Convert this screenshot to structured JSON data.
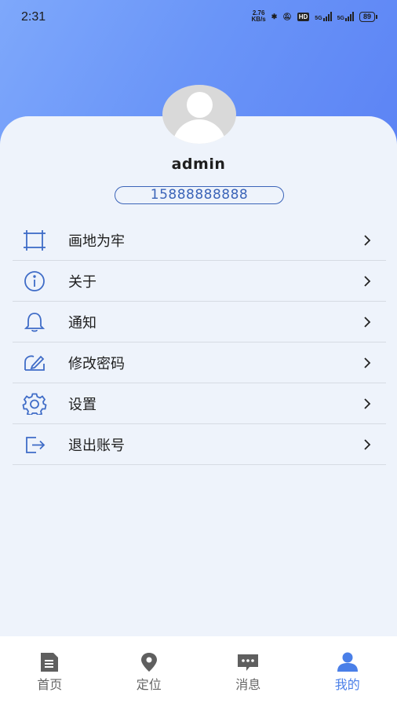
{
  "status_bar": {
    "time": "2:31",
    "speed_value": "2.76",
    "speed_unit": "KB/s",
    "hd_label": "HD",
    "net1": "5G",
    "net2": "5G",
    "battery": "89"
  },
  "profile": {
    "username": "admin",
    "phone": "15888888888"
  },
  "menu": [
    {
      "label": "画地为牢",
      "icon": "frame-icon"
    },
    {
      "label": "关于",
      "icon": "info-icon"
    },
    {
      "label": "通知",
      "icon": "bell-icon"
    },
    {
      "label": "修改密码",
      "icon": "edit-password-icon"
    },
    {
      "label": "设置",
      "icon": "gear-icon"
    },
    {
      "label": "退出账号",
      "icon": "logout-icon"
    }
  ],
  "tabs": [
    {
      "label": "首页",
      "icon": "document-icon",
      "active": false
    },
    {
      "label": "定位",
      "icon": "location-pin-icon",
      "active": false
    },
    {
      "label": "消息",
      "icon": "message-icon",
      "active": false
    },
    {
      "label": "我的",
      "icon": "user-icon",
      "active": true
    }
  ],
  "colors": {
    "accent": "#4a7fe8",
    "header_gradient_start": "#7ea8fb",
    "header_gradient_end": "#5b82f4",
    "icon_blue": "#3f6cc7"
  }
}
